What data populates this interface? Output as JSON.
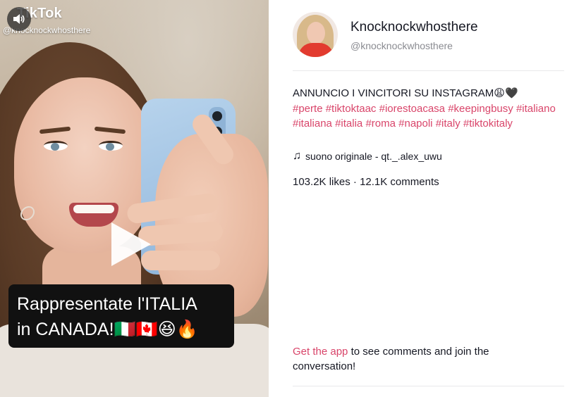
{
  "video": {
    "logo_text": "TikTok",
    "overlay_handle": "@knocknockwhosthere",
    "caption_line1": "Rappresentate l'ITALIA",
    "caption_line2": "in CANADA!🇮🇹🇨🇦😆🔥",
    "sound_icon": "speaker-icon",
    "play_icon": "play-icon"
  },
  "profile": {
    "display_name": "Knocknockwhosthere",
    "username": "@knocknockwhosthere"
  },
  "post": {
    "description_text": "ANNUNCIO I VINCITORI SU INSTAGRAM😩🖤",
    "hashtags": [
      "#perte",
      "#tiktoktaac",
      "#iorestoacasa",
      "#keepingbusy",
      "#italiano",
      "#italiana",
      "#italia",
      "#roma",
      "#napoli",
      "#italy",
      "#tiktokitaly"
    ],
    "sound": "suono originale - qt._.alex_uwu",
    "likes": "103.2K likes",
    "separator": " · ",
    "comments": "12.1K comments"
  },
  "cta": {
    "link": "Get the app",
    "text": " to see comments and join the conversation!"
  },
  "colors": {
    "accent": "#d9456a",
    "text": "#161823",
    "muted": "#8a8b91"
  }
}
